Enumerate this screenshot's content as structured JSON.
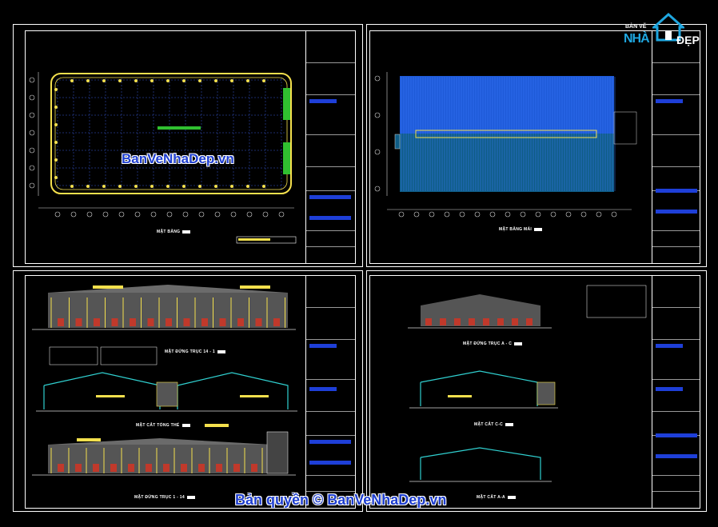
{
  "logo": {
    "top": "BẢN VẼ",
    "nha": "NHÀ",
    "dep": "ĐẸP"
  },
  "sheets": {
    "floor_plan": {
      "label": "MẶT BẰNG"
    },
    "roof_plan": {
      "label": "MẶT BẰNG MÁI"
    },
    "elevation_14_1": {
      "label": "MẶT ĐỨNG TRỤC 14 - 1"
    },
    "section_overall": {
      "label": "MẶT CẮT TỔNG THỂ"
    },
    "elevation_1_14": {
      "label": "MẶT ĐỨNG TRỤC 1 - 14"
    },
    "elevation_a_c": {
      "label": "MẶT ĐỨNG TRỤC A - C"
    },
    "section_cc": {
      "label": "MẶT CẮT C-C"
    },
    "section_aa": {
      "label": "MẶT CẮT A-A"
    }
  },
  "watermark": {
    "center": "BanVeNhaDep.vn",
    "copyright": "Bản quyền © BanVeNhaDep.vn"
  },
  "colors": {
    "background": "#000000",
    "frame": "#ffffff",
    "grid": "#3b5bd6",
    "roof_light": "#1e5ad8",
    "roof_dark": "#0f5d86",
    "wall_yellow": "#f4e04d",
    "column_green": "#30c030",
    "annotation_red": "#e02020",
    "watermark_blue": "#1f3fd0"
  }
}
